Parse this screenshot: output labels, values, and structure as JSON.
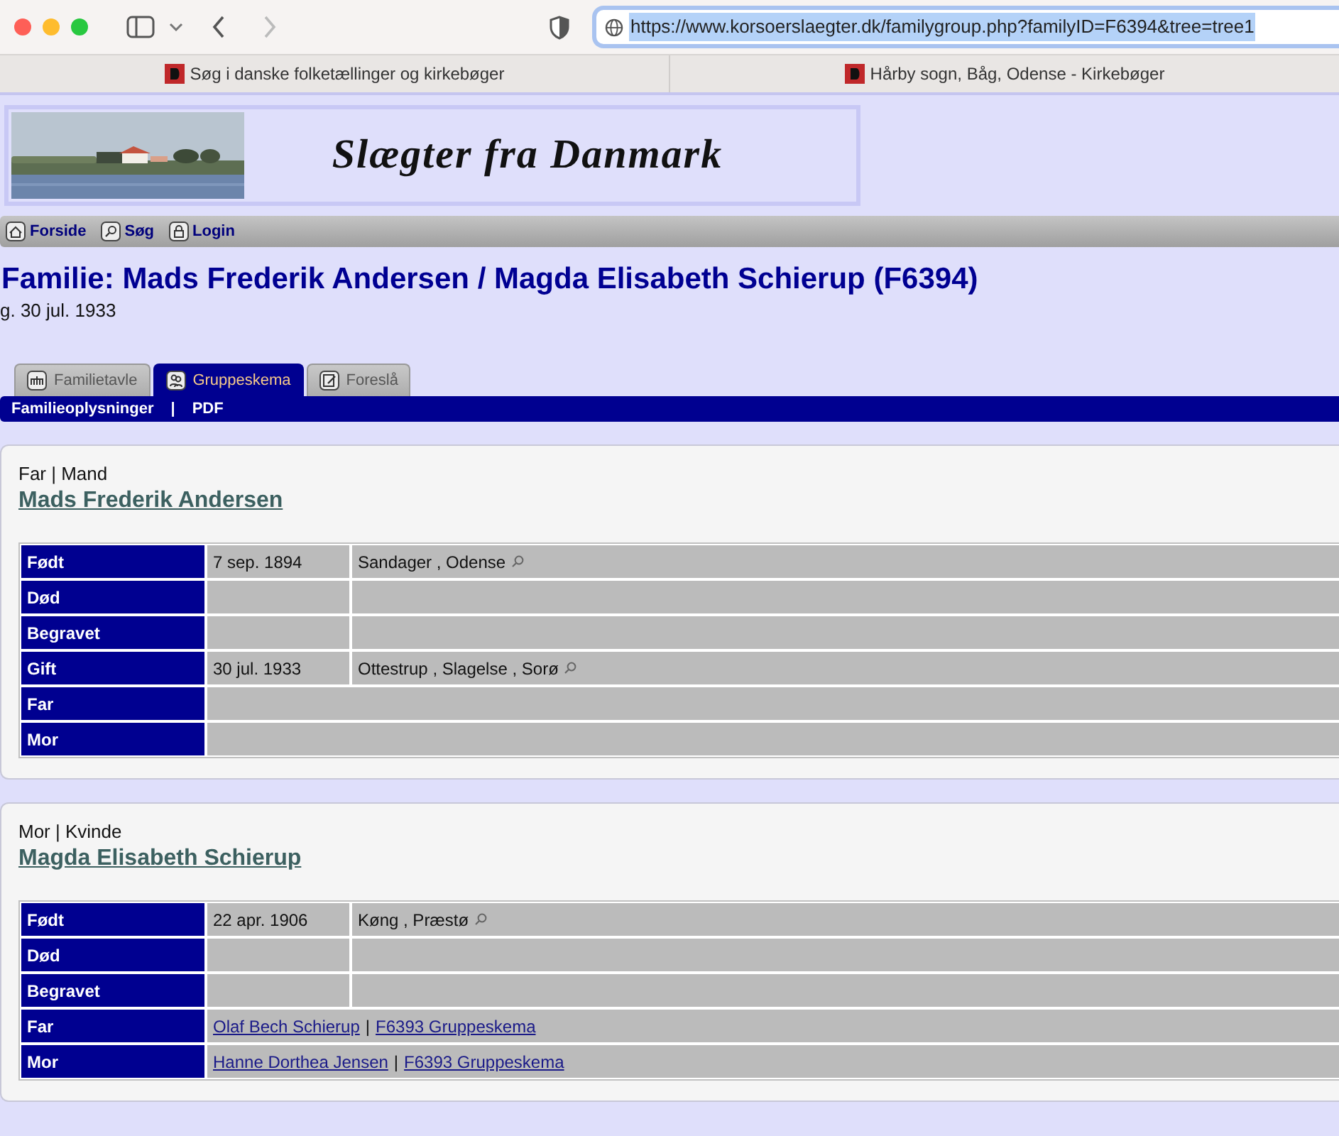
{
  "browser": {
    "url": "https://www.korsoerslaegter.dk/familygroup.php?familyID=F6394&tree=tree1",
    "url_selected": true
  },
  "bookmarks": [
    {
      "label": "Søg i danske folketællinger og kirkebøger"
    },
    {
      "label": "Hårby sogn, Båg, Odense - Kirkebøger"
    }
  ],
  "site": {
    "banner_title": "Slægter fra Danmark",
    "nav": [
      {
        "label": "Forside",
        "kind": "home"
      },
      {
        "label": "Søg",
        "kind": "search"
      },
      {
        "label": "Login",
        "kind": "lock"
      }
    ]
  },
  "family": {
    "heading": "Familie: Mads Frederik Andersen / Magda Elisabeth Schierup (F6394)",
    "subtitle": "g. 30 jul. 1933"
  },
  "tabs": [
    {
      "label": "Familietavle",
      "kind": "chart",
      "selected": false
    },
    {
      "label": "Gruppeskema",
      "kind": "group",
      "selected": true
    },
    {
      "label": "Foreslå",
      "kind": "edit",
      "selected": false
    }
  ],
  "subnav": {
    "links": [
      {
        "label": "Familieoplysninger"
      },
      {
        "label": "PDF"
      }
    ],
    "separator": "|"
  },
  "people": [
    {
      "role": "Far | Mand",
      "name": "Mads Frederik Andersen",
      "rows": [
        {
          "kind": "event",
          "label": "Født",
          "date": "7 sep. 1894",
          "place": "Sandager , Odense",
          "lookup": true
        },
        {
          "kind": "event",
          "label": "Død"
        },
        {
          "kind": "event",
          "label": "Begravet"
        },
        {
          "kind": "event",
          "label": "Gift",
          "date": "30 jul. 1933",
          "place": "Ottestrup , Slagelse , Sorø",
          "lookup": true
        },
        {
          "kind": "parent",
          "label": "Far"
        },
        {
          "kind": "parent",
          "label": "Mor"
        }
      ]
    },
    {
      "role": "Mor | Kvinde",
      "name": "Magda Elisabeth Schierup",
      "rows": [
        {
          "kind": "event",
          "label": "Født",
          "date": "22 apr. 1906",
          "place": "Køng , Præstø",
          "lookup": true
        },
        {
          "kind": "event",
          "label": "Død"
        },
        {
          "kind": "event",
          "label": "Begravet"
        },
        {
          "kind": "parent",
          "label": "Far",
          "links": [
            {
              "text": "Olaf Bech Schierup"
            },
            {
              "text": "F6393 Gruppeskema"
            }
          ],
          "separator": "|"
        },
        {
          "kind": "parent",
          "label": "Mor",
          "links": [
            {
              "text": "Hanne Dorthea Jensen"
            },
            {
              "text": "F6393 Gruppeskema"
            }
          ],
          "separator": "|"
        }
      ]
    }
  ]
}
